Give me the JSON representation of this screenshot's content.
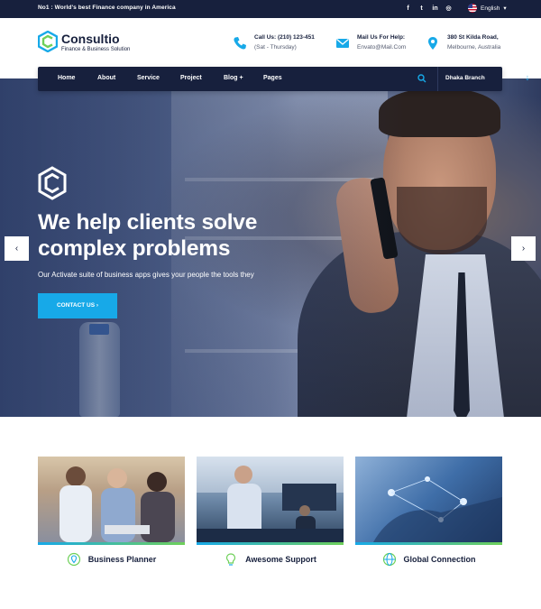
{
  "topbar": {
    "tagline": "No1 : World's best Finance company in America",
    "social_icons": [
      "facebook-icon",
      "twitter-icon",
      "linkedin-icon",
      "instagram-icon"
    ],
    "social_glyphs": [
      "f",
      "t",
      "in",
      "◎"
    ],
    "language": "English",
    "language_caret": "▾"
  },
  "header": {
    "brand": "Consultio",
    "brand_sub": "Finance & Business Solution",
    "contacts": [
      {
        "icon": "phone-icon",
        "title": "Call Us: (210) 123-451",
        "detail": "(Sat - Thursday)"
      },
      {
        "icon": "mail-icon",
        "title": "Mail Us For Help:",
        "detail": "Envato@Mail.Com"
      },
      {
        "icon": "location-pin-icon",
        "title": "380 St Kilda Road,",
        "detail": "Melbourne, Australia"
      }
    ]
  },
  "nav": {
    "items": [
      {
        "label": "Home"
      },
      {
        "label": "About"
      },
      {
        "label": "Service"
      },
      {
        "label": "Project"
      },
      {
        "label": "Blog +"
      },
      {
        "label": "Pages"
      }
    ],
    "branch": "Dhaka Branch",
    "branch_caret": "⇣"
  },
  "hero": {
    "headline_line1": "We help clients solve",
    "headline_line2": "complex problems",
    "subtext": "Our Activate suite of business apps gives your people the tools they",
    "cta": "CONTACT US ›",
    "prev_arrow": "‹",
    "next_arrow": "›"
  },
  "services": [
    {
      "title": "Business Planner",
      "icon": "business-planner-icon"
    },
    {
      "title": "Awesome Support",
      "icon": "support-bulb-icon"
    },
    {
      "title": "Global Connection",
      "icon": "globe-icon"
    }
  ],
  "colors": {
    "navy": "#17203d",
    "accent_blue": "#17a9e8",
    "accent_green": "#6fd05a"
  }
}
